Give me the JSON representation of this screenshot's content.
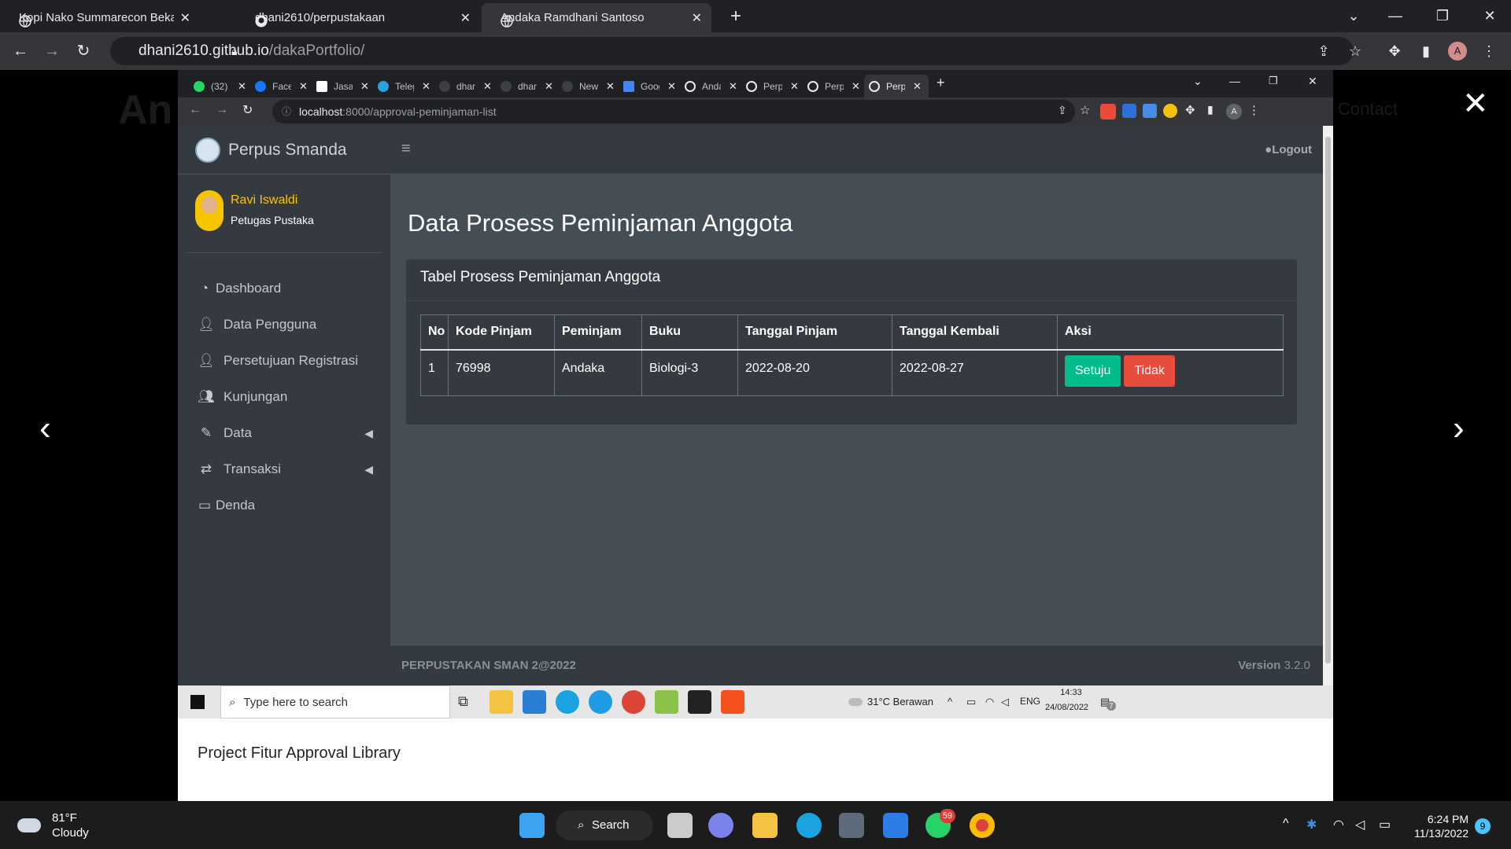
{
  "outer_browser": {
    "tabs": [
      {
        "title": "Kopi Nako Summarecon Bekasi"
      },
      {
        "title": "dhani2610/perpustakaan"
      },
      {
        "title": "Andaka Ramdhani Santoso"
      }
    ],
    "url_host": "dhani2610.github.io",
    "url_path": "/dakaPortfolio/",
    "profile_initial": "A"
  },
  "gallery": {
    "bg_title": "An",
    "bg_contact": "Contact",
    "caption": "Project Fitur Approval Library"
  },
  "inner_browser": {
    "tabs": [
      {
        "title": "(32) \\",
        "color": "#25d366"
      },
      {
        "title": "Facel",
        "color": "#1877f2"
      },
      {
        "title": "Jasa",
        "color": "#ffffff"
      },
      {
        "title": "Teleg",
        "color": "#2aa3df"
      },
      {
        "title": "dhan",
        "color": "#3c4043"
      },
      {
        "title": "dhan",
        "color": "#3c4043"
      },
      {
        "title": "New",
        "color": "#3c4043"
      },
      {
        "title": "Goog",
        "color": "#4285f4"
      },
      {
        "title": "Anda",
        "color": "#e8eaed"
      },
      {
        "title": "Perp",
        "color": "#e8eaed"
      },
      {
        "title": "Perp",
        "color": "#e8eaed"
      },
      {
        "title": "Perp",
        "color": "#e8eaed"
      }
    ],
    "url_host": "localhost",
    "url_path": ":8000/approval-peminjaman-list",
    "profile_initial": "A"
  },
  "app": {
    "brand": "Perpus Smanda",
    "user": {
      "name": "Ravi Iswaldi",
      "role": "Petugas Pustaka"
    },
    "menu": [
      {
        "label": "Dashboard",
        "icon": "tachometer-icon"
      },
      {
        "label": "Data Pengguna",
        "icon": "user-icon"
      },
      {
        "label": "Persetujuan Registrasi",
        "icon": "user-clock-icon"
      },
      {
        "label": "Kunjungan",
        "icon": "users-icon"
      },
      {
        "label": "Data",
        "icon": "edit-icon"
      },
      {
        "label": "Transaksi",
        "icon": "exchange-icon"
      },
      {
        "label": "Denda",
        "icon": "money-icon"
      }
    ],
    "logout": "Logout",
    "page_title": "Data Prosess Peminjaman Anggota",
    "card_title": "Tabel Prosess Peminjaman Anggota",
    "table": {
      "headers": [
        "No",
        "Kode Pinjam",
        "Peminjam",
        "Buku",
        "Tanggal Pinjam",
        "Tanggal Kembali",
        "Aksi"
      ],
      "rows": [
        {
          "no": "1",
          "kode": "76998",
          "peminjam": "Andaka",
          "buku": "Biologi-3",
          "tgl_pinjam": "2022-08-20",
          "tgl_kembali": "2022-08-27"
        }
      ],
      "approve_label": "Setuju",
      "reject_label": "Tidak"
    },
    "footer_left": "PERPUSTAKAN SMAN 2@2022",
    "footer_version_label": "Version",
    "footer_version": "3.2.0"
  },
  "inner_taskbar": {
    "search_placeholder": "Type here to search",
    "weather": "31°C  Berawan",
    "lang": "ENG",
    "time": "14:33",
    "date": "24/08/2022",
    "notif_count": "7"
  },
  "os_taskbar": {
    "weather_temp": "81°F",
    "weather_desc": "Cloudy",
    "search_label": "Search",
    "whatsapp_badge": "59",
    "time": "6:24 PM",
    "date": "11/13/2022",
    "notif_count": "9"
  },
  "colors": {
    "sidebar": "#343a40",
    "content": "#454d55",
    "approve": "#00bc8c",
    "reject": "#e74c3c",
    "user_name": "#ffc107"
  }
}
